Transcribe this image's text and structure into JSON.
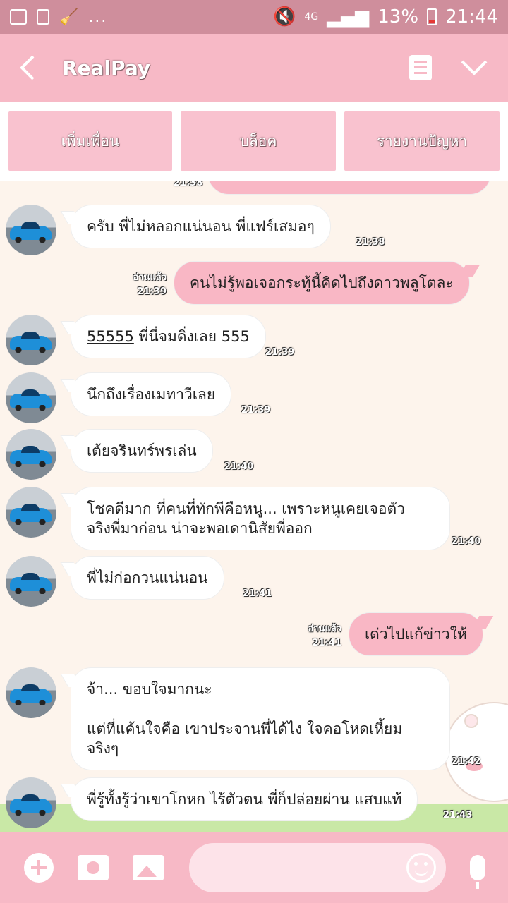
{
  "status_bar": {
    "network": "4G",
    "battery": "13%",
    "time": "21:44",
    "dots": "..."
  },
  "header": {
    "title": "RealPay",
    "icons": [
      "back-arrow-icon",
      "notes-icon",
      "chevron-down-icon"
    ]
  },
  "actions": {
    "add_friend": "เพิ่มเพื่อน",
    "block": "บล็อค",
    "report": "รายงานปัญหา"
  },
  "messages": [
    {
      "side": "left",
      "text": "ครับ พี่ไม่หลอกแน่นอน พี่แฟร์เสมอๆ",
      "time": "21:38"
    },
    {
      "side": "right",
      "text": "คนไม่รู้พอเจอกระทู้นี้คิดไปถึงดาวพลูโตละ",
      "time": "21:39",
      "read": "อ่านแล้ว"
    },
    {
      "side": "left",
      "text_link": "55555",
      "text": " พี่นี่จมดิ่งเลย 555",
      "time": "21:39"
    },
    {
      "side": "left",
      "text": "นึกถึงเรื่องเมทาวีเลย",
      "time": "21:39"
    },
    {
      "side": "left",
      "text": "เต้ยจรินทร์พรเล่น",
      "time": "21:40"
    },
    {
      "side": "left",
      "text": "โชคดีมาก ที่คนที่ทักพีคือหนู... เพราะหนูเคยเจอตัว\nจริงพี่มาก่อน น่าจะพอเดานิสัยพี่ออก",
      "time": "21:40"
    },
    {
      "side": "left",
      "text": "พี่ไม่ก่อกวนแน่นอน",
      "time": "21:41"
    },
    {
      "side": "right",
      "text": "เด่วไปแก้ข่าวให้",
      "time": "21:41",
      "read": "อ่านแล้ว"
    },
    {
      "side": "left",
      "text": "จ้า... ขอบใจมากนะ\n\nแต่ที่แค้นใจคือ เขาประจานพี่ได้ไง ใจคอโหดเหี้ยม\nจริงๆ",
      "time": "21:42"
    },
    {
      "side": "left",
      "text": "พี่รู้ทั้งรู้ว่าเขาโกหก ไร้ตัวตน พี่ก็ปล่อยผ่าน แสบแท้",
      "time": "21:43"
    }
  ],
  "top_partial_time": "21:38",
  "colors": {
    "statusbar": "#cf8e9c",
    "header": "#f7b9c6",
    "bubble_right": "#f9b7c5",
    "chat_bg": "#fdf4ec"
  }
}
